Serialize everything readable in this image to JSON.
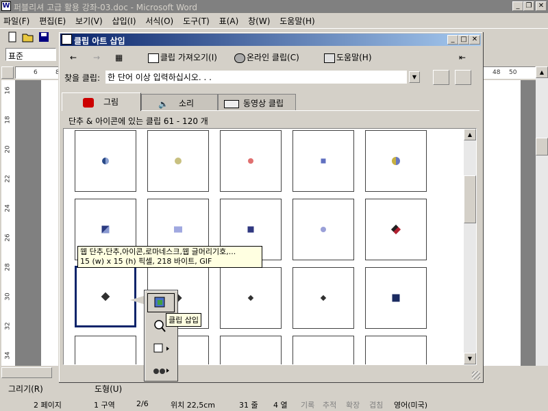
{
  "word": {
    "title": "퍼블리셔 고급 활용 강좌-03.doc - Microsoft Word",
    "menu": [
      "파일(F)",
      "편집(E)",
      "보기(V)",
      "삽입(I)",
      "서식(O)",
      "도구(T)",
      "표(A)",
      "창(W)",
      "도움말(H)"
    ],
    "style_value": "표준",
    "ruler_numbers": [
      "6",
      "8",
      "48",
      "50"
    ],
    "vruler_numbers": [
      "16",
      "18",
      "20",
      "22",
      "24",
      "26",
      "28",
      "30",
      "32",
      "34"
    ],
    "draw_label": "그리기(R)",
    "autoshape_label": "도형(U)",
    "status": {
      "page": "2 페이지",
      "section": "1 구역",
      "pages": "2/6",
      "position": "위치 22,5cm",
      "line": "31 줄",
      "col": "4 열",
      "rec": "기록",
      "trk": "추적",
      "ext": "확장",
      "ovr": "겹침",
      "lang": "영어(미국)"
    }
  },
  "dialog": {
    "title": "클립 아트 삽입",
    "toolbar": {
      "import": "클립 가져오기(I)",
      "online": "온라인 클립(C)",
      "help": "도움말(H)"
    },
    "find_label": "찾을 클립:",
    "find_value": "한 단어 이상 입력하십시오. . .",
    "tabs": [
      "그림",
      "소리",
      "동영상 클립"
    ],
    "category": "단추 & 아이콘에 있는 클립 61 - 120 개",
    "tooltip_line1": "웹 단추,단추,아이콘,로마네스크,웹 글머리기호,...",
    "tooltip_line2": "15 (w) x 15 (h) 픽셀, 218 바이트, GIF",
    "popup_tooltip": "클립 삽입"
  },
  "colors": {
    "title_active": "#0a246a",
    "face": "#d4d0c8",
    "tooltip": "#ffffe1"
  }
}
